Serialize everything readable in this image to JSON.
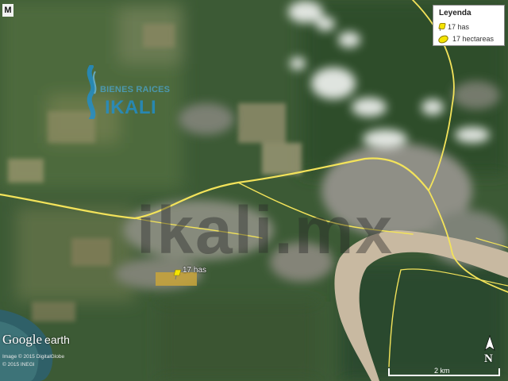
{
  "map": {
    "type": "satellite",
    "labels": {
      "corner_marker": "M",
      "property_label": "17 has",
      "watermark": "ikali.mx"
    }
  },
  "legend": {
    "title": "Leyenda",
    "items": [
      {
        "symbol": "yellow-pushpin",
        "label": "17 has"
      },
      {
        "symbol": "yellow-polygon",
        "label": "17 hectareas"
      }
    ]
  },
  "brand": {
    "top": "BIENES RAICES",
    "bottom": "IKALI"
  },
  "google_earth": {
    "logo_google": "Google",
    "logo_earth": "earth",
    "credits": [
      "Image © 2015 DigitalGlobe",
      "© 2015 INEGI"
    ]
  },
  "north_arrow": {
    "label": "N"
  },
  "scale": {
    "label": "2 km"
  },
  "colors": {
    "vegetation": "#34502f",
    "river": "#c8b9a1",
    "roads": "#f3e35a",
    "legend_accent": "#f5e400",
    "brand": "#1f8fcf"
  }
}
